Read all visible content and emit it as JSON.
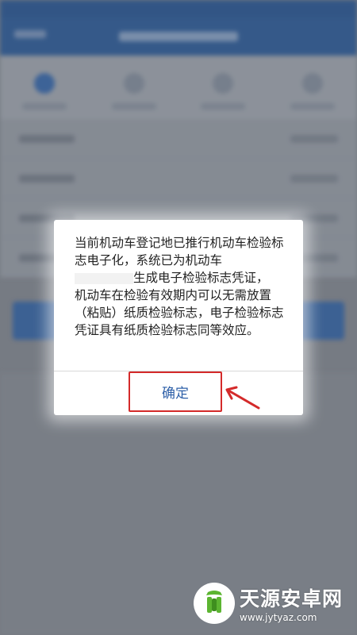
{
  "dialog": {
    "message_line1": "当前机动车登记地已推行机动车检验标志电子化，系统已为机动车",
    "message_line2": "生成电子检验标志凭证，",
    "message_line3": "机动车在检验有效期内可以无需放置（粘贴）纸质检验标志，电子检验标志凭证具有纸质检验标志同等效应。",
    "confirm_label": "确定"
  },
  "watermark": {
    "name": "天源安卓网",
    "url": "www.jytyaz.com"
  },
  "colors": {
    "confirm_text": "#2d5fa8",
    "highlight": "#d42a2a",
    "header_blue": "#33629f"
  }
}
